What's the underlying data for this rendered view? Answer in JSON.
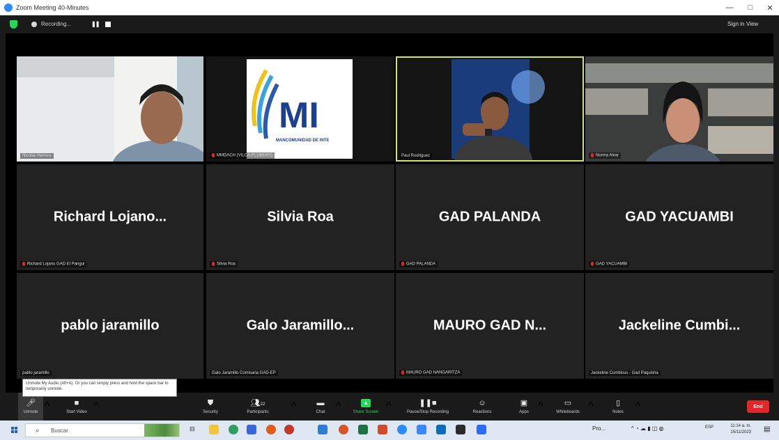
{
  "window": {
    "title": "Zoom Meeting 40-Minutes",
    "minimize": "—",
    "maximize": "□",
    "close": "✕"
  },
  "topbar": {
    "recording_label": "Recording...",
    "pause_glyph": "❚❚",
    "sign_in": "Sign in",
    "view": "View"
  },
  "tiles": [
    {
      "label": "Nicolas Herrera"
    },
    {
      "label": "MMDACH (VILCA-PLUMIAPI)",
      "logo_text": "MI",
      "logo_subtext": "MANCOMUNIDAD DE INTE"
    },
    {
      "label": "Paul Rodriguez"
    },
    {
      "label": "Norma Alvar"
    },
    {
      "name": "Richard  Lojano...",
      "label": "Richard Lojano GAD El Pangui"
    },
    {
      "name": "Silvia Roa",
      "label": "Silvia Roa"
    },
    {
      "name": "GAD PALANDA",
      "label": "GAD PALANDA"
    },
    {
      "name": "GAD YACUAMBI",
      "label": "GAD YACUAMBI"
    },
    {
      "name": "pablo jaramillo",
      "label": "pablo jaramillo"
    },
    {
      "name": "Galo  Jaramillo...",
      "label": "Galo Jaramillo Comisaria GAD-EP"
    },
    {
      "name": "MAURO GAD N...",
      "label": "MAURO GAD NANGARITZA"
    },
    {
      "name": "Jackeline  Cumbi...",
      "label": "Jackeline Cumbicus - Gad Paquisha"
    }
  ],
  "tooltip": "Unmute My Audio (Alt+A). Or you can simply press and hold the space bar to temporarily unmute.",
  "toolbar": {
    "items": [
      {
        "label": "Unmute",
        "icon": "mic-muted-icon",
        "glyph": "🎤︎"
      },
      {
        "label": "Start Video",
        "icon": "video-off-icon",
        "glyph": "■"
      },
      {
        "label": "Security",
        "icon": "shield-icon",
        "glyph": "⛊"
      },
      {
        "label": "Participants",
        "icon": "participants-icon",
        "glyph": "👥︎",
        "count": "22"
      },
      {
        "label": "Chat",
        "icon": "chat-icon",
        "glyph": "▬"
      },
      {
        "label": "Share Screen",
        "icon": "share-screen-icon",
        "glyph": "▲"
      },
      {
        "label": "Pause/Stop Recording",
        "icon": "recording-icon",
        "glyph": "❚❚■"
      },
      {
        "label": "Reactions",
        "icon": "reactions-icon",
        "glyph": "☺"
      },
      {
        "label": "Apps",
        "icon": "apps-icon",
        "glyph": "▣"
      },
      {
        "label": "Whiteboards",
        "icon": "whiteboard-icon",
        "glyph": "▭"
      },
      {
        "label": "Notes",
        "icon": "notes-icon",
        "glyph": "▯"
      }
    ],
    "end_label": "End",
    "share_color": "#23d959",
    "end_color": "#e02828"
  },
  "taskbar": {
    "search_placeholder": "Buscar",
    "tray_text": "Pro...",
    "lang": "ESP",
    "time": "11:14 a. m.",
    "date": "15/11/2023"
  }
}
